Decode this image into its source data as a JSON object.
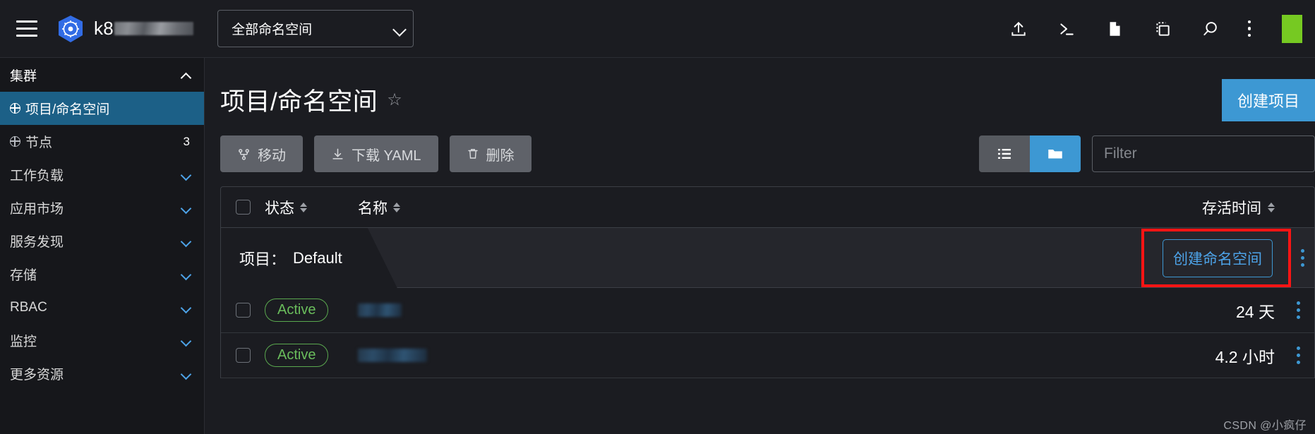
{
  "topbar": {
    "menu_icon": "hamburger-icon",
    "logo_icon": "kubernetes-helm-logo",
    "brand_label": "k8",
    "namespace_select": {
      "value": "全部命名空间",
      "caret": "chevron-down-icon"
    },
    "icons": [
      {
        "name": "upload-icon",
        "label": "上传"
      },
      {
        "name": "terminal-icon",
        "label": "终端"
      },
      {
        "name": "file-icon",
        "label": "文件"
      },
      {
        "name": "copy-icon",
        "label": "复制"
      },
      {
        "name": "search-icon",
        "label": "搜索"
      },
      {
        "name": "more-vertical-icon",
        "label": "更多"
      }
    ]
  },
  "sidebar": {
    "group_label": "集群",
    "items": [
      {
        "label": "项目/命名空间",
        "icon": "globe-icon",
        "active": true,
        "count": ""
      },
      {
        "label": "节点",
        "icon": "globe-icon",
        "active": false,
        "count": "3"
      }
    ],
    "sections": [
      {
        "label": "工作负载"
      },
      {
        "label": "应用市场"
      },
      {
        "label": "服务发现"
      },
      {
        "label": "存储"
      },
      {
        "label": "RBAC"
      },
      {
        "label": "监控"
      },
      {
        "label": "更多资源"
      }
    ]
  },
  "page": {
    "title": "项目/命名空间",
    "favorite_icon": "star-icon",
    "create_project_label": "创建项目"
  },
  "toolbar": {
    "move_label": "移动",
    "download_yaml_label": "下载 YAML",
    "delete_label": "删除",
    "view_list_icon": "list-view-icon",
    "view_group_icon": "folder-view-icon",
    "active_view": "folder",
    "filter_placeholder": "Filter",
    "filter_value": ""
  },
  "table": {
    "columns": [
      {
        "key": "status",
        "label": "状态",
        "sortable": true
      },
      {
        "key": "name",
        "label": "名称",
        "sortable": true
      },
      {
        "key": "age",
        "label": "存活时间",
        "sortable": true
      }
    ],
    "group": {
      "label": "项目：",
      "value": "Default",
      "create_namespace_label": "创建命名空间",
      "annotation_color": "#fc1414",
      "row_menu_icon": "more-vertical-icon"
    },
    "rows": [
      {
        "status": "Active",
        "name": "",
        "name_redacted": true,
        "name_width": 62,
        "age": "24 天",
        "menu_icon": "more-vertical-icon"
      },
      {
        "status": "Active",
        "name": "",
        "name_redacted": true,
        "name_width": 98,
        "age": "4.2 小时",
        "menu_icon": "more-vertical-icon"
      }
    ]
  },
  "watermark": "CSDN @小疯仔",
  "colors": {
    "background": "#1b1c21",
    "sidebar": "#16171b",
    "accent_blue": "#3d98d3",
    "active_nav": "#1c6087",
    "status_green": "#6abd5c",
    "annotation_red": "#fc1414",
    "avatar_green": "#76c922",
    "button_grey": "#5f6269"
  }
}
